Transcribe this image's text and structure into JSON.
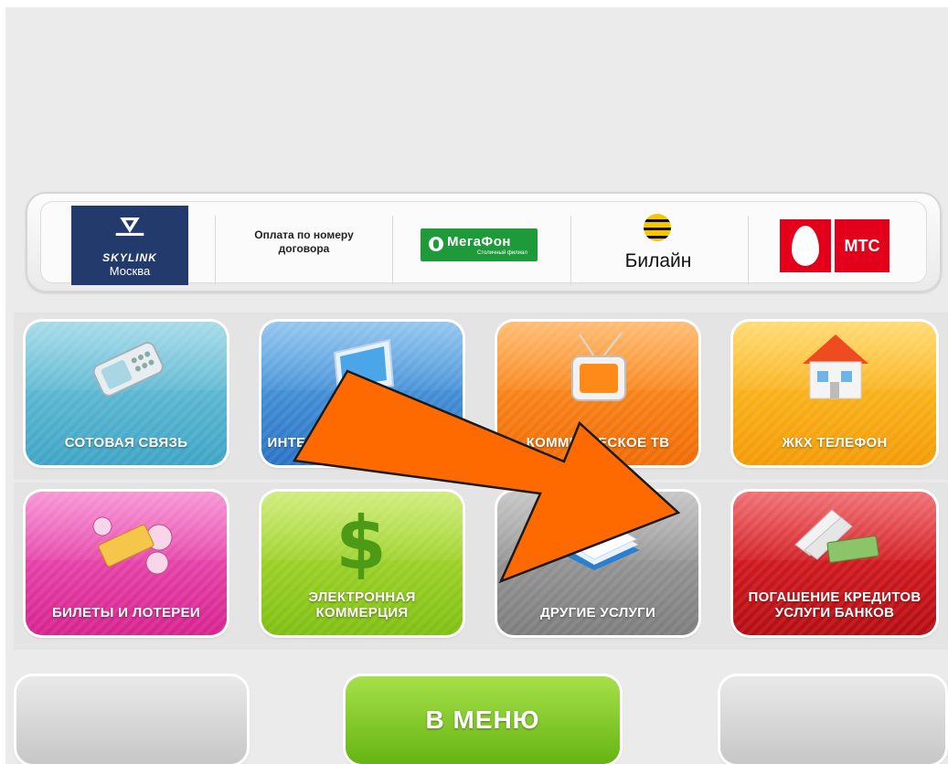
{
  "providers": {
    "skylink_brand": "SKYLINK",
    "skylink_city": "Москва",
    "contract_payment": "Оплата по номеру договора",
    "megafon_name": "МегаФон",
    "megafon_sub": "Столичный филиал",
    "beeline_name": "Билайн",
    "mts_name": "МТС"
  },
  "tiles": [
    {
      "label": "СОТОВАЯ СВЯЗЬ",
      "color": "#3ea5c5",
      "icon": "mobile-phone-icon"
    },
    {
      "label": "ИНТЕРНЕТ IP-ТЕЛЕФОНИЯ",
      "color": "#2a73c4",
      "icon": "monitor-icon"
    },
    {
      "label": "КОММЕРЧЕСКОЕ ТВ",
      "color": "#f06b05",
      "icon": "tv-icon"
    },
    {
      "label": "ЖКХ ТЕЛЕФОН",
      "color": "#f39b07",
      "icon": "house-icon"
    },
    {
      "label": "БИЛЕТЫ И ЛОТЕРЕИ",
      "color": "#d6238e",
      "icon": "lottery-ticket-icon"
    },
    {
      "label": "ЭЛЕКТРОННАЯ КОММЕРЦИЯ",
      "color": "#7fbf12",
      "icon": "dollar-icon"
    },
    {
      "label": "ДРУГИЕ УСЛУГИ",
      "color": "#7d7d7d",
      "icon": "documents-icon"
    },
    {
      "label": "ПОГАШЕНИЕ КРЕДИТОВ УСЛУГИ БАНКОВ",
      "color": "#b40d12",
      "icon": "money-folder-icon"
    }
  ],
  "bottom": {
    "menu_label": "В МЕНЮ"
  },
  "overlay": {
    "arrow_color": "#ff6a00",
    "arrow_icon": "pointer-arrow-icon"
  }
}
